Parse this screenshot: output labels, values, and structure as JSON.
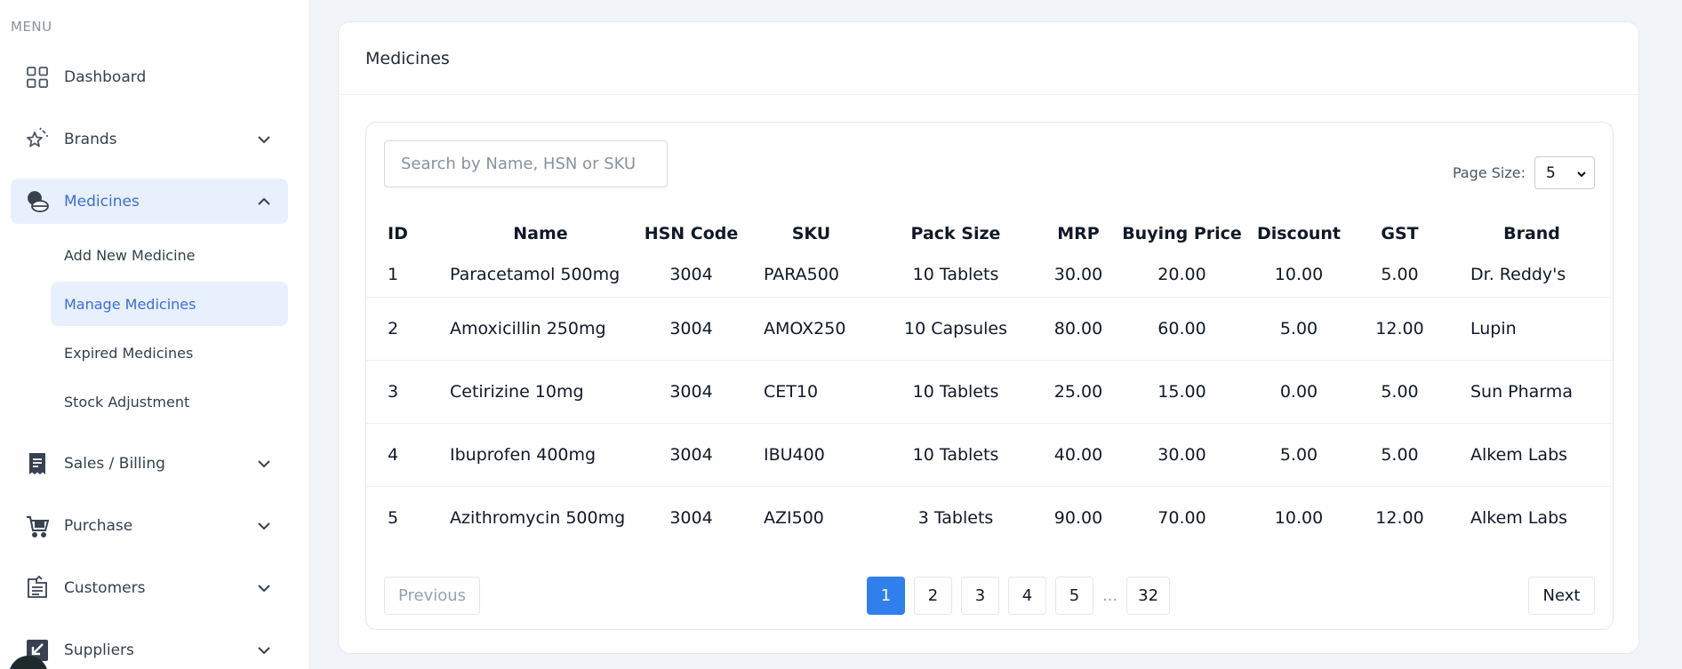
{
  "sidebar": {
    "menu_label": "MENU",
    "items": [
      {
        "label": "Dashboard"
      },
      {
        "label": "Brands"
      },
      {
        "label": "Medicines"
      },
      {
        "label": "Sales / Billing"
      },
      {
        "label": "Purchase"
      },
      {
        "label": "Customers"
      },
      {
        "label": "Suppliers"
      }
    ],
    "medicines_sub": [
      {
        "label": "Add New Medicine"
      },
      {
        "label": "Manage Medicines"
      },
      {
        "label": "Expired Medicines"
      },
      {
        "label": "Stock Adjustment"
      }
    ]
  },
  "main": {
    "title": "Medicines",
    "search_placeholder": "Search by Name, HSN or SKU",
    "page_size_label": "Page Size:",
    "page_size_value": "5",
    "columns": [
      "ID",
      "Name",
      "HSN Code",
      "SKU",
      "Pack Size",
      "MRP",
      "Buying Price",
      "Discount",
      "GST",
      "Brand"
    ],
    "rows": [
      [
        "1",
        "Paracetamol 500mg",
        "3004",
        "PARA500",
        "10 Tablets",
        "30.00",
        "20.00",
        "10.00",
        "5.00",
        "Dr. Reddy's"
      ],
      [
        "2",
        "Amoxicillin 250mg",
        "3004",
        "AMOX250",
        "10 Capsules",
        "80.00",
        "60.00",
        "5.00",
        "12.00",
        "Lupin"
      ],
      [
        "3",
        "Cetirizine 10mg",
        "3004",
        "CET10",
        "10 Tablets",
        "25.00",
        "15.00",
        "0.00",
        "5.00",
        "Sun Pharma"
      ],
      [
        "4",
        "Ibuprofen 400mg",
        "3004",
        "IBU400",
        "10 Tablets",
        "40.00",
        "30.00",
        "5.00",
        "5.00",
        "Alkem Labs"
      ],
      [
        "5",
        "Azithromycin 500mg",
        "3004",
        "AZI500",
        "3 Tablets",
        "90.00",
        "70.00",
        "10.00",
        "12.00",
        "Alkem Labs"
      ]
    ],
    "pagination": {
      "previous": "Previous",
      "next": "Next",
      "pages": [
        "1",
        "2",
        "3",
        "4",
        "5"
      ],
      "ellipsis": "...",
      "last": "32",
      "current": "1"
    }
  },
  "colors": {
    "accent": "#3c6fd8",
    "active_bg": "#e9f0fd",
    "page_active": "#2f80ed"
  }
}
